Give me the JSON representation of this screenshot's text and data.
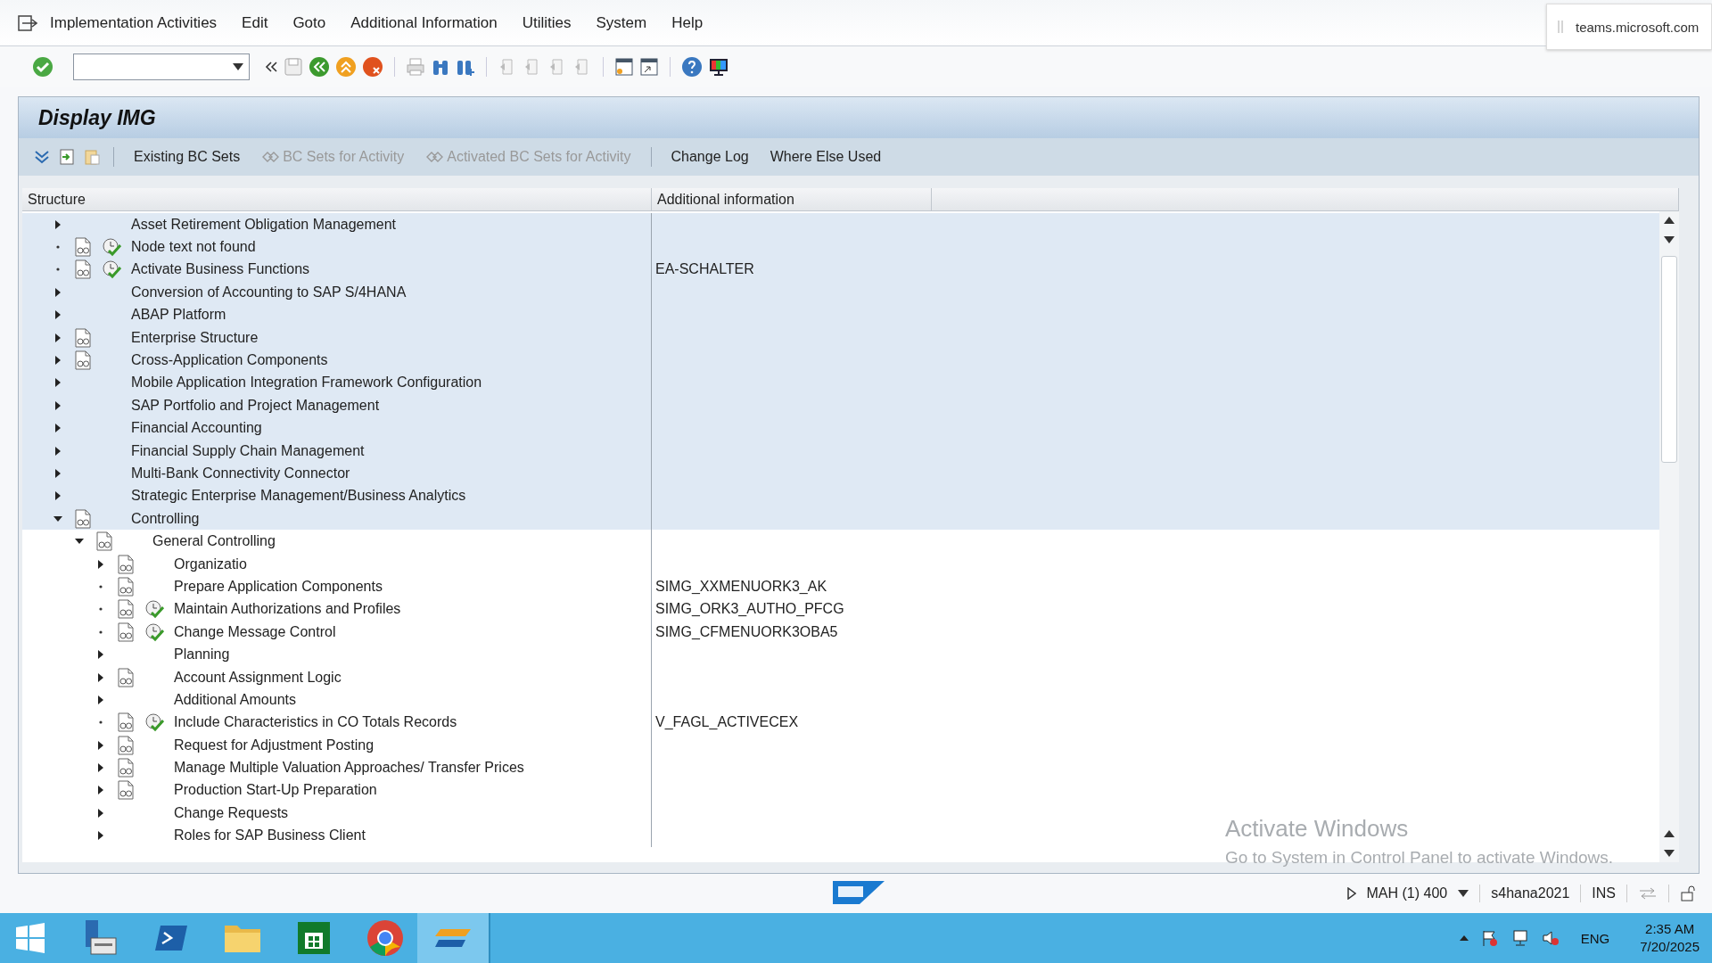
{
  "menu": [
    "Implementation Activities",
    "Edit",
    "Goto",
    "Additional Information",
    "Utilities",
    "System",
    "Help"
  ],
  "notification": {
    "text": "teams.microsoft.com"
  },
  "screen_title": "Display IMG",
  "app_toolbar": [
    {
      "label": "Existing BC Sets",
      "disabled": false,
      "kind": "text"
    },
    {
      "label": "BC Sets for Activity",
      "disabled": true,
      "kind": "bcset"
    },
    {
      "label": "Activated BC Sets for Activity",
      "disabled": true,
      "kind": "bcset"
    },
    {
      "label": "Change Log",
      "disabled": false,
      "kind": "text"
    },
    {
      "label": "Where Else Used",
      "disabled": false,
      "kind": "text"
    }
  ],
  "columns": [
    "Structure",
    "Additional information"
  ],
  "tree": [
    {
      "label": "Asset Retirement Obligation Management",
      "kind": "node",
      "expanded": false,
      "selected": true
    },
    {
      "label": "Node text not found",
      "kind": "leaf",
      "doc": true,
      "activity": true,
      "selected": true
    },
    {
      "label": "Activate Business Functions",
      "kind": "leaf",
      "doc": true,
      "activity": true,
      "info": "EA-SCHALTER",
      "selected": true
    },
    {
      "label": "Conversion of Accounting to SAP S/4HANA",
      "kind": "node",
      "expanded": false,
      "selected": true
    },
    {
      "label": "ABAP Platform",
      "kind": "node",
      "expanded": false,
      "selected": true
    },
    {
      "label": "Enterprise Structure",
      "kind": "node",
      "expanded": false,
      "doc": true,
      "selected": true
    },
    {
      "label": "Cross-Application Components",
      "kind": "node",
      "expanded": false,
      "doc": true,
      "selected": true
    },
    {
      "label": "Mobile Application Integration Framework Configuration",
      "kind": "node",
      "expanded": false,
      "selected": true
    },
    {
      "label": "SAP Portfolio and Project Management",
      "kind": "node",
      "expanded": false,
      "selected": true
    },
    {
      "label": "Financial Accounting",
      "kind": "node",
      "expanded": false,
      "selected": true
    },
    {
      "label": "Financial Supply Chain Management",
      "kind": "node",
      "expanded": false,
      "selected": true
    },
    {
      "label": "Multi-Bank Connectivity Connector",
      "kind": "node",
      "expanded": false,
      "selected": true
    },
    {
      "label": "Strategic Enterprise Management/Business Analytics",
      "kind": "node",
      "expanded": false,
      "selected": true
    },
    {
      "label": "Controlling",
      "kind": "node",
      "expanded": true,
      "doc": true,
      "selected": true,
      "children": [
        {
          "label": "General Controlling",
          "kind": "node",
          "expanded": true,
          "doc": true,
          "selected": false,
          "children": [
            {
              "label": "Organizatio",
              "kind": "node",
              "expanded": false,
              "doc": true,
              "selected": false
            },
            {
              "label": "Prepare Application Components",
              "kind": "leaf",
              "doc": true,
              "info": "SIMG_XXMENUORK3_AK",
              "selected": false
            },
            {
              "label": "Maintain Authorizations and Profiles",
              "kind": "leaf",
              "doc": true,
              "activity": true,
              "info": "SIMG_ORK3_AUTHO_PFCG",
              "selected": false
            },
            {
              "label": "Change Message Control",
              "kind": "leaf",
              "doc": true,
              "activity": true,
              "info": "SIMG_CFMENUORK3OBA5",
              "selected": false
            },
            {
              "label": "Planning",
              "kind": "node",
              "expanded": false,
              "selected": false
            },
            {
              "label": "Account Assignment Logic",
              "kind": "node",
              "expanded": false,
              "doc": true,
              "selected": false
            },
            {
              "label": "Additional Amounts",
              "kind": "node",
              "expanded": false,
              "selected": false
            },
            {
              "label": "Include Characteristics in CO Totals Records",
              "kind": "leaf",
              "doc": true,
              "activity": true,
              "info": "V_FAGL_ACTIVECEX",
              "selected": false
            },
            {
              "label": "Request for Adjustment Posting",
              "kind": "node",
              "expanded": false,
              "doc": true,
              "selected": false
            },
            {
              "label": "Manage Multiple Valuation Approaches/ Transfer Prices",
              "kind": "node",
              "expanded": false,
              "doc": true,
              "selected": false
            },
            {
              "label": "Production Start-Up Preparation",
              "kind": "node",
              "expanded": false,
              "doc": true,
              "selected": false
            },
            {
              "label": "Change Requests",
              "kind": "node",
              "expanded": false,
              "selected": false
            },
            {
              "label": "Roles for SAP Business Client",
              "kind": "node",
              "expanded": false,
              "selected": false
            }
          ]
        }
      ]
    }
  ],
  "activation_notice": {
    "title": "Activate Windows",
    "text": "Go to System in Control Panel to activate Windows."
  },
  "status_bar": {
    "system": "MAH (1) 400",
    "server": "s4hana2021",
    "mode": "INS"
  },
  "taskbar": {
    "language": "ENG",
    "time": "2:35 AM",
    "date": "7/20/2025"
  }
}
